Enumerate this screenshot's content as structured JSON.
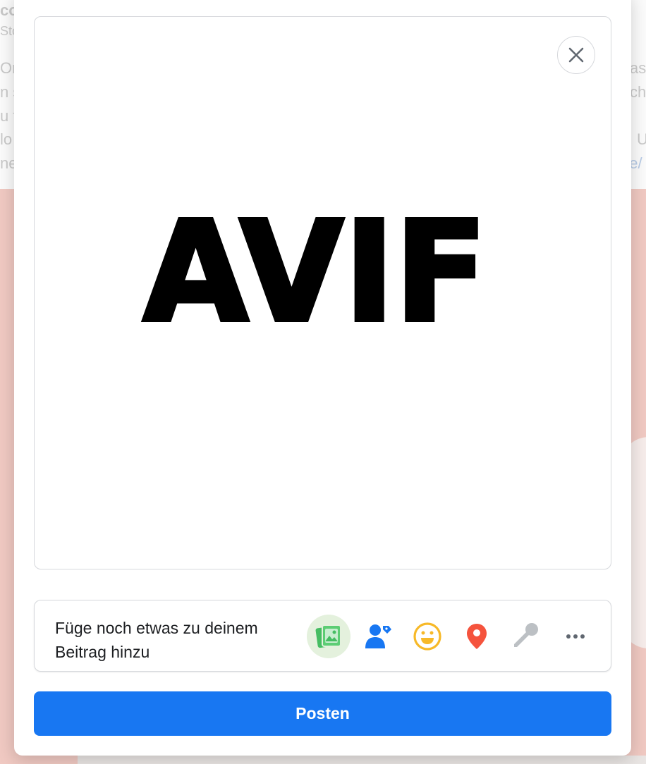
{
  "background": {
    "lines_left": [
      "co",
      "Sto",
      "Or",
      "n s",
      "u f",
      "lo",
      "ne"
    ],
    "lines_right": [
      "as",
      "ch",
      "U",
      "de/"
    ]
  },
  "preview": {
    "image_text": "AVIF",
    "close_icon": "close-icon"
  },
  "add_to_post": {
    "label": "Füge noch etwas zu deinem Beitrag hinzu",
    "tools": [
      {
        "icon": "photo-video-icon",
        "color": "#45bd62",
        "active": true
      },
      {
        "icon": "tag-people-icon",
        "color": "#1877f2"
      },
      {
        "icon": "feeling-emoji-icon",
        "color": "#f7b928"
      },
      {
        "icon": "location-pin-icon",
        "color": "#f5533d"
      },
      {
        "icon": "microphone-icon",
        "color": "#bcc0c4"
      },
      {
        "icon": "more-options-icon",
        "color": "#606770"
      }
    ]
  },
  "post_button": {
    "label": "Posten",
    "color": "#1877f2"
  }
}
